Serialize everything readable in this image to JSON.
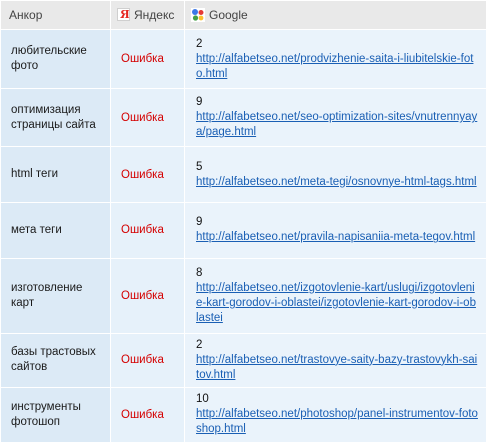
{
  "header": {
    "anchor_label": "Анкор",
    "yandex_label": "Яндекс",
    "google_label": "Google",
    "yandex_icon": "yandex-icon",
    "google_icon": "google-icon"
  },
  "rows": [
    {
      "anchor": "любительские фото",
      "yandex": "Ошибка",
      "google_pos": "2",
      "google_url": "http://alfabetseo.net/prodvizhenie-saita-i-liubitelskie-foto.html"
    },
    {
      "anchor": "оптимизация страницы сайта",
      "yandex": "Ошибка",
      "google_pos": "9",
      "google_url": "http://alfabetseo.net/seo-optimization-sites/vnutrennyaya/page.html"
    },
    {
      "anchor": "html теги",
      "yandex": "Ошибка",
      "google_pos": "5",
      "google_url": "http://alfabetseo.net/meta-tegi/osnovnye-html-tags.html"
    },
    {
      "anchor": "мета теги",
      "yandex": "Ошибка",
      "google_pos": "9",
      "google_url": "http://alfabetseo.net/pravila-napisaniia-meta-tegov.html"
    },
    {
      "anchor": "изготовление карт",
      "yandex": "Ошибка",
      "google_pos": "8",
      "google_url": "http://alfabetseo.net/izgotovlenie-kart/uslugi/izgotovlenie-kart-gorodov-i-oblastei/izgotovlenie-kart-gorodov-i-oblastei"
    },
    {
      "anchor": "базы трастовых сайтов",
      "yandex": "Ошибка",
      "google_pos": "2",
      "google_url": "http://alfabetseo.net/trastovye-saity-bazy-trastovykh-saitov.html"
    },
    {
      "anchor": "инструменты фотошоп",
      "yandex": "Ошибка",
      "google_pos": "10",
      "google_url": "http://alfabetseo.net/photoshop/panel-instrumentov-fotoshop.html"
    }
  ],
  "colors": {
    "error": "#d40000",
    "link": "#1a5fb4",
    "header_bg": "#e9e9e9",
    "row_bg": "#deeefa"
  }
}
